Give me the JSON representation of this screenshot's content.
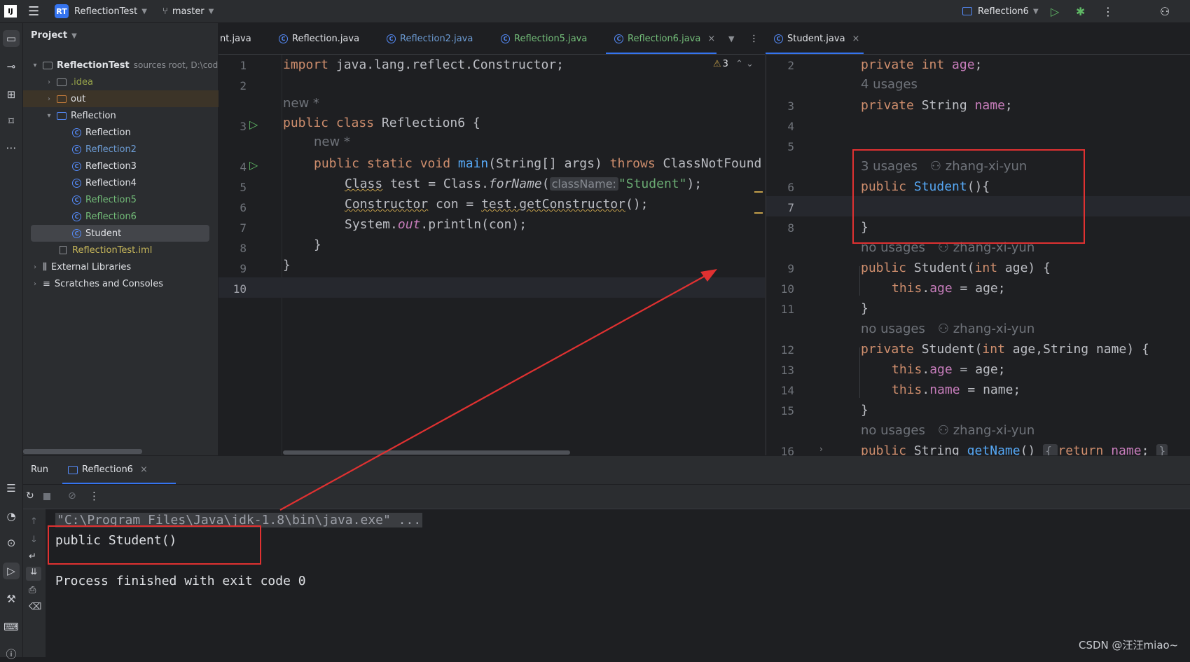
{
  "titlebar": {
    "project_badge": "RT",
    "project_name": "ReflectionTest",
    "branch": "master",
    "run_config": "Reflection6"
  },
  "project_panel": {
    "title": "Project",
    "root_name": "ReflectionTest",
    "root_hint": "sources root, D:\\cod",
    "items": [
      {
        "label": ".idea"
      },
      {
        "label": "out"
      },
      {
        "label": "Reflection"
      },
      {
        "label": "Reflection"
      },
      {
        "label": "Reflection2"
      },
      {
        "label": "Reflection3"
      },
      {
        "label": "Reflection4"
      },
      {
        "label": "Reflection5"
      },
      {
        "label": "Reflection6"
      },
      {
        "label": "Student"
      },
      {
        "label": "ReflectionTest.iml"
      },
      {
        "label": "External Libraries"
      },
      {
        "label": "Scratches and Consoles"
      }
    ]
  },
  "tabs_left": [
    "nt.java",
    "Reflection.java",
    "Reflection2.java",
    "Reflection5.java",
    "Reflection6.java"
  ],
  "tabs_right": [
    "Student.java"
  ],
  "editor_left": {
    "warning_count": "3",
    "line_numbers": [
      "1",
      "2",
      "3",
      "4",
      "5",
      "6",
      "7",
      "8",
      "9",
      "10"
    ],
    "hint_new": "new *",
    "inlay_param": "className:",
    "import_line": "import java.lang.reflect.Constructor;",
    "class_decl": {
      "kw": "public class ",
      "name": "Reflection6 {"
    },
    "main_decl": {
      "kw1": "public static void ",
      "fn": "main",
      "rest": "(String[] args) ",
      "kw2": "throws ",
      "exc": "ClassNotFound"
    },
    "line5": {
      "type": "Class",
      "mid": " test = Class.",
      "call": "forName",
      "open": "(",
      "str": "\"Student\"",
      "close": ");"
    },
    "line6": {
      "type": "Constructor",
      "mid": " con = ",
      "call": "test.getConstructor",
      "close": "();"
    },
    "line7": {
      "pre": "System.",
      "fld": "out",
      "post": ".println(con);"
    },
    "brace_inner": "}",
    "brace_outer": "}"
  },
  "editor_right": {
    "line_numbers": [
      "2",
      "3",
      "4",
      "5",
      "6",
      "7",
      "8",
      "9",
      "10",
      "11",
      "12",
      "13",
      "14",
      "15",
      "16"
    ],
    "age_decl": {
      "kw": "private int ",
      "fld": "age",
      "end": ";"
    },
    "usages_4": "4 usages",
    "name_decl": {
      "kw": "private ",
      "type": "String ",
      "fld": "name",
      "end": ";"
    },
    "usages_3": "3 usages",
    "author": "zhang-xi-yun",
    "no_usages": "no usages",
    "ctor1": {
      "kw": "public ",
      "fn": "Student",
      "rest": "(){"
    },
    "close_brace": "}",
    "ctor2": {
      "kw": "public ",
      "fn": "Student",
      "p1": "(",
      "kw2": "int",
      "p2": " age) {"
    },
    "this_age": {
      "kw": "this",
      "dot": ".",
      "fld": "age",
      "rest": " = age;"
    },
    "ctor3": {
      "kw": "private ",
      "fn": "Student",
      "p1": "(",
      "kw2": "int",
      "p2": " age,String name) {"
    },
    "this_name": {
      "kw": "this",
      "dot": ".",
      "fld": "name",
      "rest": " = name;"
    },
    "getter": {
      "kw": "public ",
      "type": "String ",
      "fn": "getName",
      "p": "() ",
      "b1": "{ ",
      "kw2": "return ",
      "fld": "name",
      "semi": "; ",
      "b2": "}"
    }
  },
  "run_panel": {
    "title": "Run",
    "tab": "Reflection6",
    "cmd_line": "\"C:\\Program Files\\Java\\jdk-1.8\\bin\\java.exe\" ...",
    "output_line": "public Student()",
    "finished_line": "Process finished with exit code 0"
  },
  "watermark": "CSDN @汪汪miao~",
  "colors": {
    "annotation_red": "#e03131",
    "accent": "#3574f0"
  }
}
